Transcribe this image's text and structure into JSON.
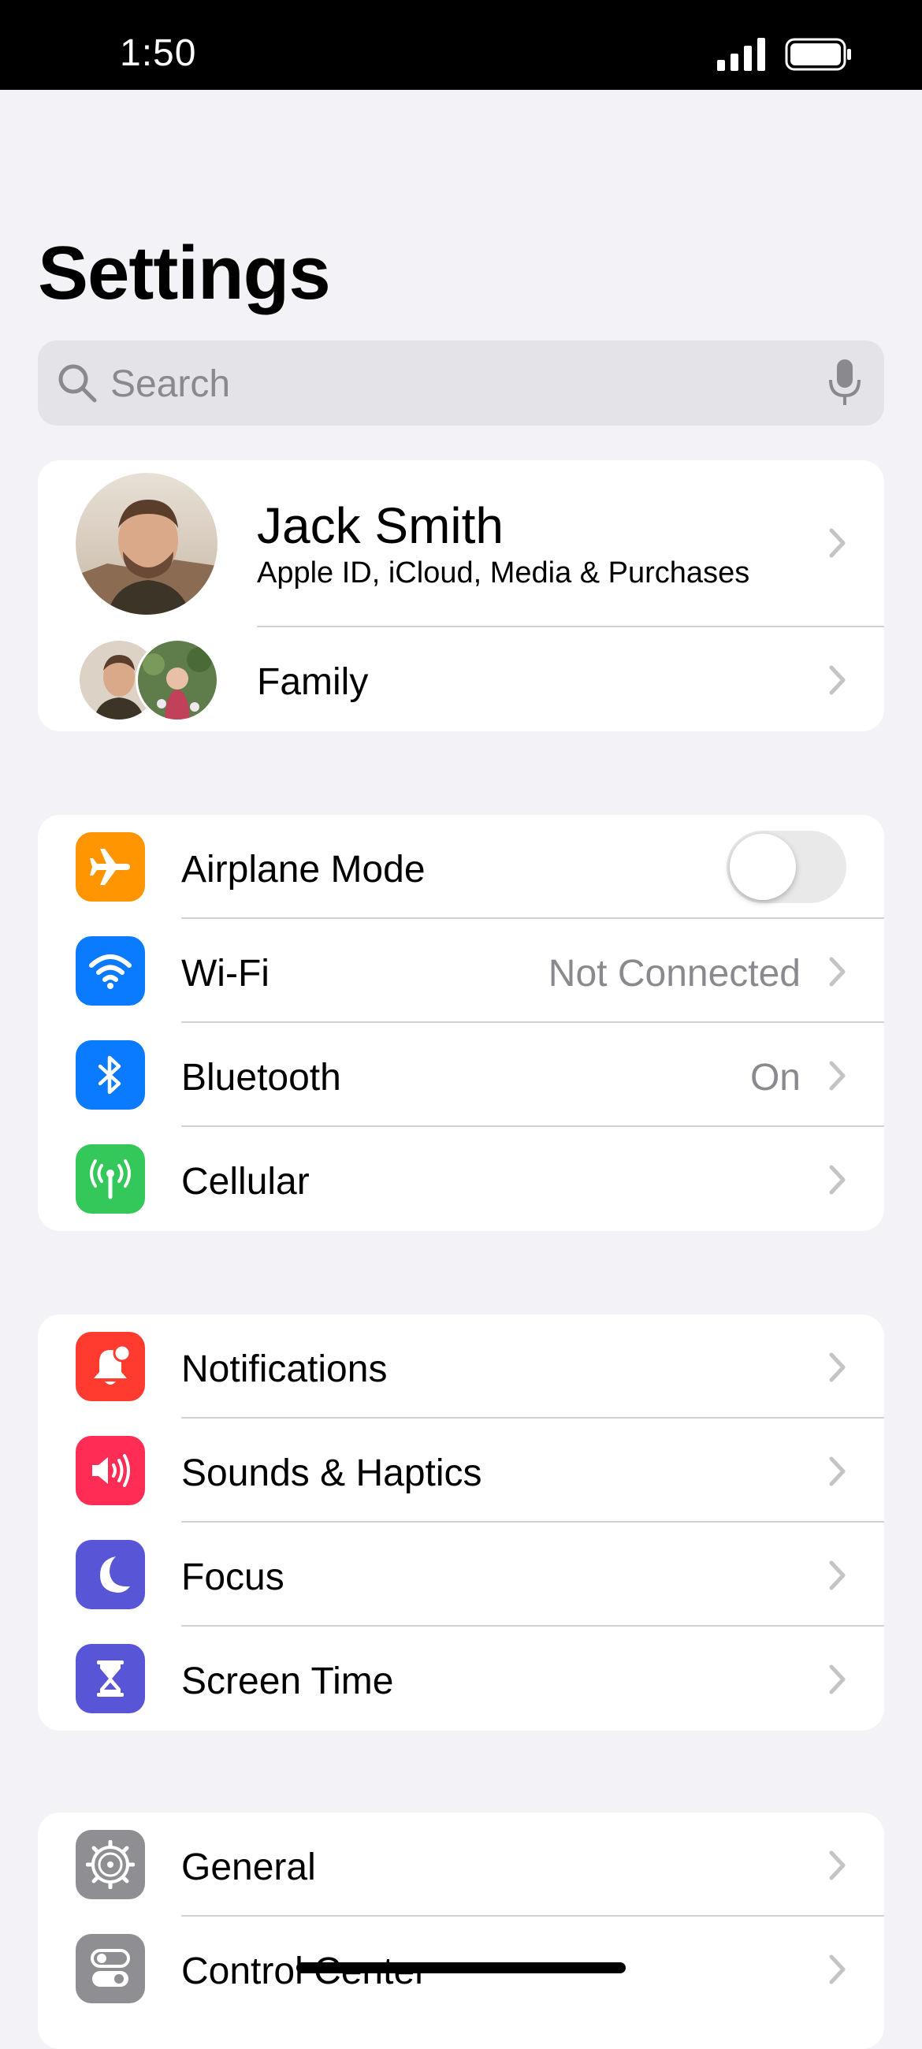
{
  "status_bar": {
    "time": "1:50"
  },
  "page": {
    "title": "Settings"
  },
  "search": {
    "placeholder": "Search"
  },
  "profile": {
    "name": "Jack Smith",
    "subtitle": "Apple ID, iCloud, Media & Purchases",
    "family_label": "Family"
  },
  "connectivity": {
    "airplane": {
      "label": "Airplane Mode",
      "toggle_on": false
    },
    "wifi": {
      "label": "Wi-Fi",
      "value": "Not Connected"
    },
    "bluetooth": {
      "label": "Bluetooth",
      "value": "On"
    },
    "cellular": {
      "label": "Cellular"
    }
  },
  "attention": {
    "notifications": {
      "label": "Notifications"
    },
    "sounds": {
      "label": "Sounds & Haptics"
    },
    "focus": {
      "label": "Focus"
    },
    "screen_time": {
      "label": "Screen Time"
    }
  },
  "system": {
    "general": {
      "label": "General"
    },
    "control_center": {
      "label": "Control Center"
    }
  },
  "colors": {
    "airplane": "#FF9500",
    "wifi": "#0A7AFF",
    "bluetooth": "#0A7AFF",
    "cellular": "#34C759",
    "notifications": "#FF3B30",
    "sounds": "#FF2D55",
    "focus": "#5856D6",
    "screen_time": "#5856D6",
    "general": "#8E8E93",
    "control_center": "#8E8E93"
  },
  "icons": [
    "search-icon",
    "microphone-icon",
    "airplane-icon",
    "wifi-icon",
    "bluetooth-icon",
    "antenna-icon",
    "bell-icon",
    "speaker-icon",
    "moon-icon",
    "hourglass-icon",
    "gear-icon",
    "toggles-icon",
    "chevron-right-icon"
  ]
}
